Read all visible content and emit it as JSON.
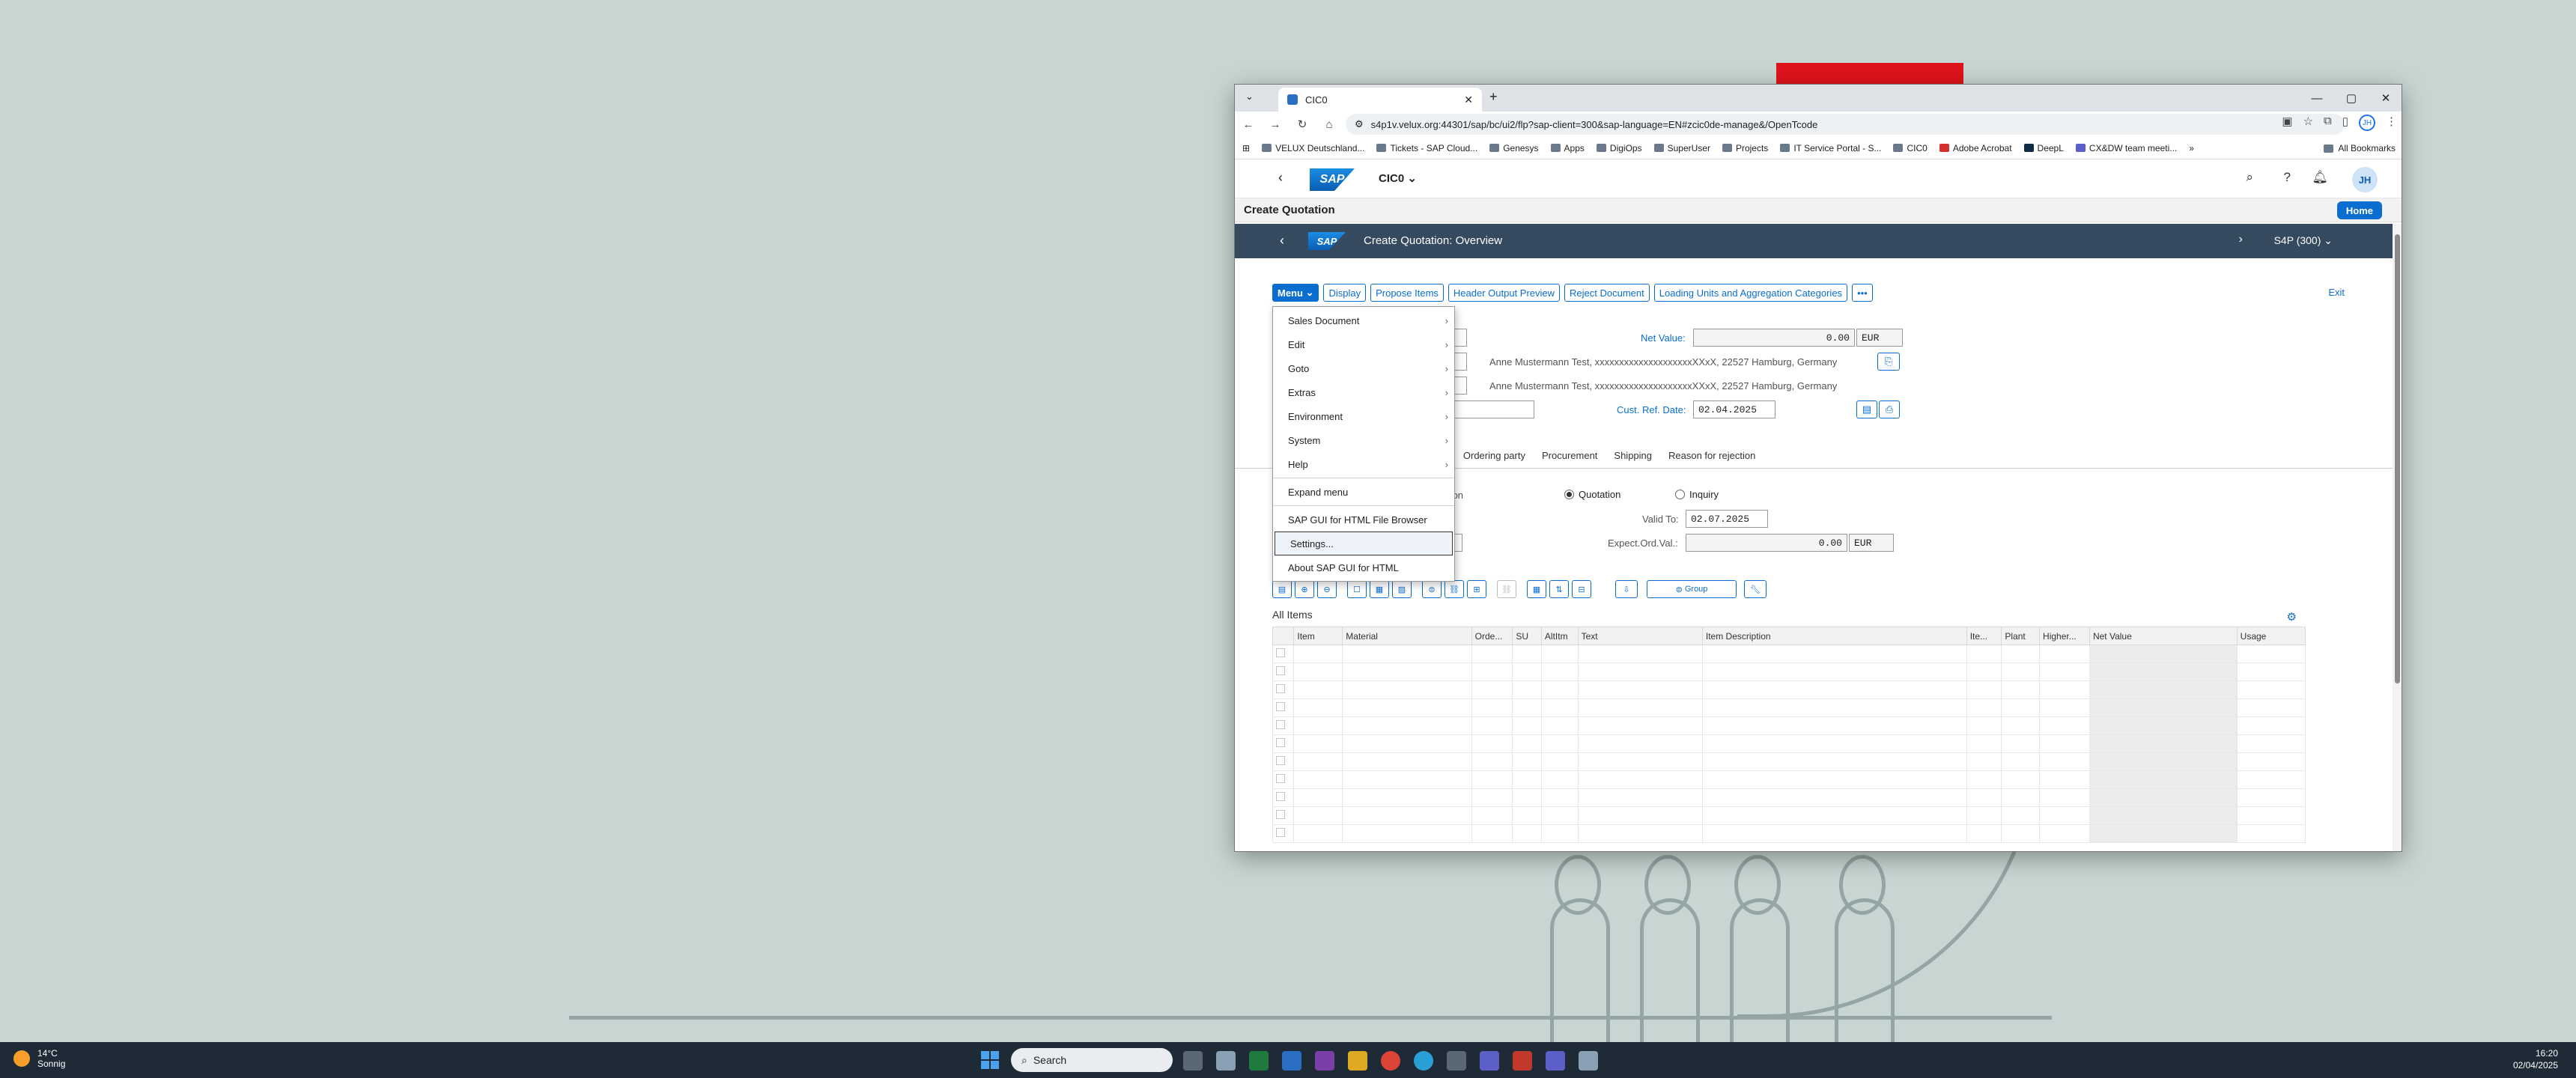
{
  "browser": {
    "tab_title": "CIC0",
    "url": "s4p1v.velux.org:44301/sap/bc/ui2/flp?sap-client=300&sap-language=EN#zcic0de-manage&/OpenTcode",
    "bookmarks": [
      "VELUX Deutschland...",
      "Tickets - SAP Cloud...",
      "Genesys",
      "Apps",
      "DigiOps",
      "SuperUser",
      "Projects",
      "IT Service Portal - S...",
      "CIC0",
      "Adobe Acrobat",
      "DeepL",
      "CX&DW team meeti..."
    ],
    "all_bookmarks": "All Bookmarks",
    "profile_initials": "JH"
  },
  "shell": {
    "app_title": "CIC0",
    "user_initials": "JH",
    "page_title": "Create Quotation",
    "home_label": "Home"
  },
  "gui": {
    "title": "Create Quotation: Overview",
    "system": "S4P (300)",
    "exit": "Exit",
    "buttons": {
      "menu": "Menu",
      "display": "Display",
      "propose": "Propose Items",
      "header_output": "Header Output Preview",
      "reject": "Reject Document",
      "loading_units": "Loading Units and Aggregation Categories",
      "more": "•••"
    }
  },
  "form": {
    "net_value_label": "Net Value:",
    "net_value": "0.00",
    "currency": "EUR",
    "sold_to_address": "Anne Mustermann Test, xxxxxxxxxxxxxxxxxxxxXXxX, 22527 Hamburg, Germany",
    "ship_to_address": "Anne Mustermann Test, xxxxxxxxxxxxxxxxxxxxXXxX, 22527 Hamburg, Germany",
    "cust_ref_date_label": "Cust. Ref. Date:",
    "cust_ref_date": "02.04.2025",
    "tabs": [
      "Ordering party",
      "Procurement",
      "Shipping",
      "Reason for rejection"
    ],
    "partial_tab": "l",
    "partial_label": "otation",
    "radio_quotation": "Quotation",
    "radio_inquiry": "Inquiry",
    "valid_to_label": "Valid To:",
    "valid_to": "02.07.2025",
    "partial_date_1": "5",
    "partial_date_2": ".2025",
    "expect_label": "Expect.Ord.Val.:",
    "expect_value": "0.00",
    "expect_currency": "EUR",
    "group_button": "Group"
  },
  "items": {
    "title": "All Items",
    "columns": [
      "Item",
      "Material",
      "Orde...",
      "SU",
      "AltItm",
      "Text",
      "Item Description",
      "Ite...",
      "Plant",
      "Higher...",
      "Net Value",
      "Usage"
    ],
    "row_count": 11
  },
  "menu": {
    "items": [
      {
        "label": "Sales Document",
        "sub": true
      },
      {
        "label": "Edit",
        "sub": true
      },
      {
        "label": "Goto",
        "sub": true
      },
      {
        "label": "Extras",
        "sub": true
      },
      {
        "label": "Environment",
        "sub": true
      },
      {
        "label": "System",
        "sub": true
      },
      {
        "label": "Help",
        "sub": true
      }
    ],
    "expand": "Expand menu",
    "file_browser": "SAP GUI for HTML File Browser",
    "settings": "Settings...",
    "about": "About SAP GUI for HTML"
  },
  "taskbar": {
    "temperature": "14°C",
    "weather": "Sonnig",
    "search": "Search",
    "time": "16:20",
    "date": "02/04/2025"
  }
}
